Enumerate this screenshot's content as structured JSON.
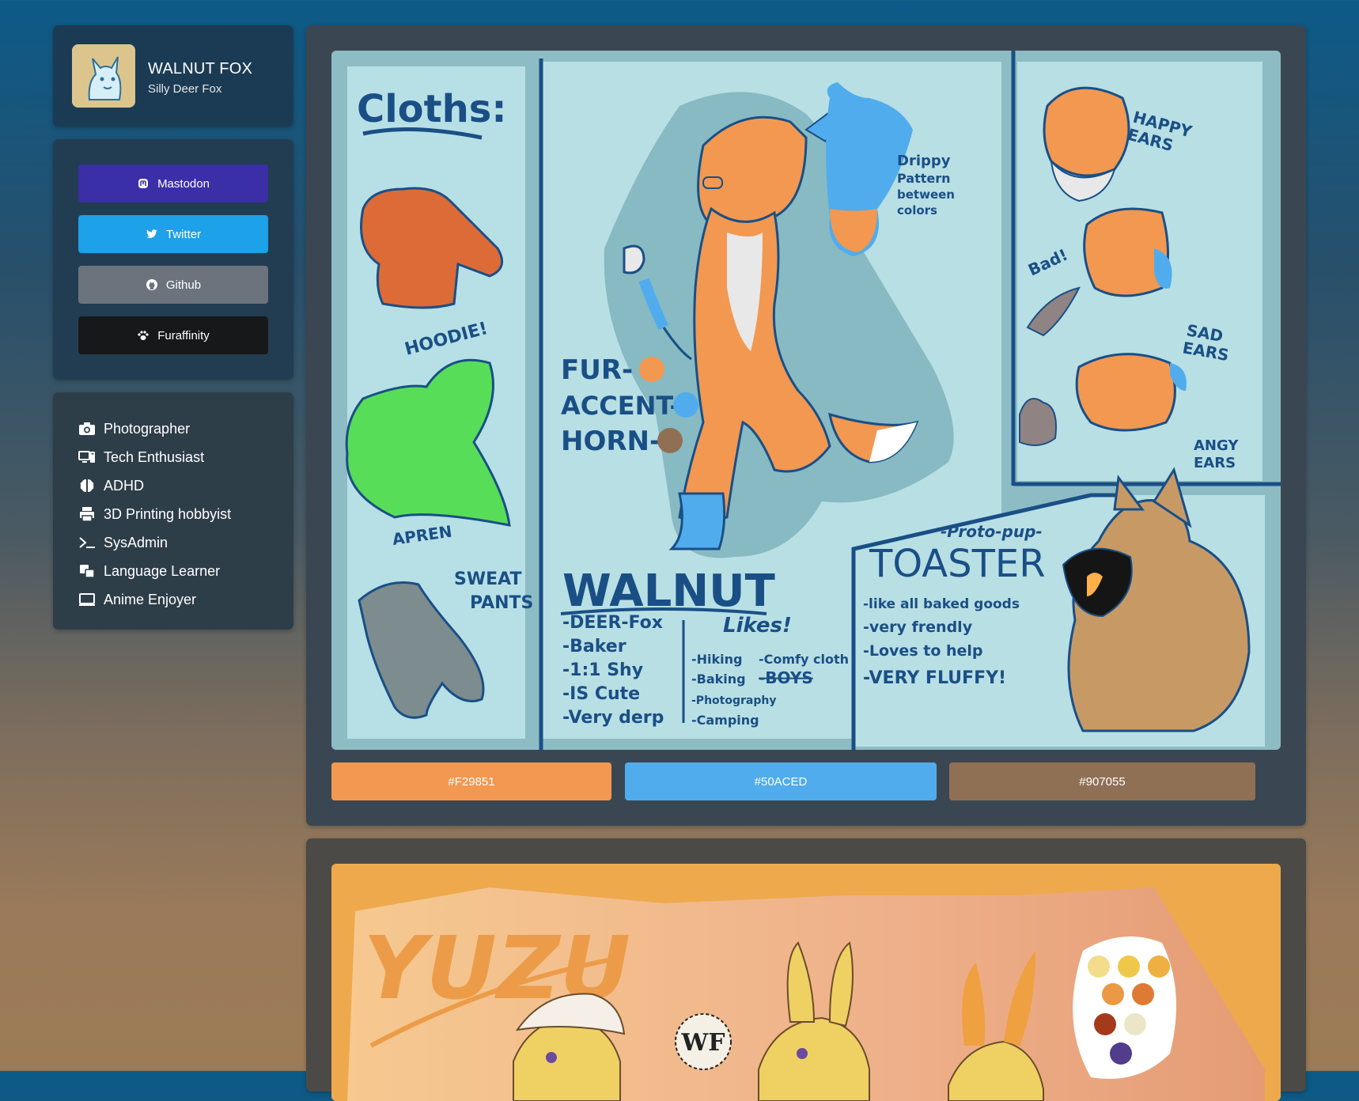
{
  "profile": {
    "name": "WALNUT FOX",
    "subtitle": "Silly Deer Fox"
  },
  "links": [
    {
      "label": "Mastodon",
      "icon": "mastodon-icon",
      "color": "#3b2fa8"
    },
    {
      "label": "Twitter",
      "icon": "twitter-icon",
      "color": "#1da1e8"
    },
    {
      "label": "Github",
      "icon": "github-icon",
      "color": "#6b737d"
    },
    {
      "label": "Furaffinity",
      "icon": "paw-icon",
      "color": "#17181a"
    }
  ],
  "about": [
    {
      "label": "Photographer",
      "icon": "camera-icon"
    },
    {
      "label": "Tech Enthusiast",
      "icon": "computer-icon"
    },
    {
      "label": "ADHD",
      "icon": "brain-icon"
    },
    {
      "label": "3D Printing hobbyist",
      "icon": "printer-icon"
    },
    {
      "label": "SysAdmin",
      "icon": "terminal-icon"
    },
    {
      "label": "Language Learner",
      "icon": "language-icon"
    },
    {
      "label": "Anime Enjoyer",
      "icon": "monitor-icon"
    }
  ],
  "refsheet": {
    "clothes_title": "Cloths:",
    "hoodie": "HOODIE!",
    "apron": "APREN",
    "sweatpants_1": "SWEAT",
    "sweatpants_2": "PANTS",
    "fur": "FUR-",
    "accent": "ACCENT-",
    "horn": "HORN-",
    "drippy_1": "Drippy",
    "drippy_2": "Pattern",
    "drippy_3": "between",
    "drippy_4": "colors",
    "happy_1": "HAPPY",
    "happy_2": "EARS",
    "bad": "Bad!",
    "sad_1": "SAD",
    "sad_2": "EARS",
    "angy_1": "ANGY",
    "angy_2": "EARS",
    "name": "WALNUT",
    "traits": [
      "-DEER-Fox",
      "-Baker",
      "-1:1 Shy",
      "-IS Cute",
      "-Very derp"
    ],
    "likes_title": "Likes!",
    "likes_col1": [
      "-Hiking",
      "-Baking",
      "-Photography",
      "-Camping"
    ],
    "likes_col2": [
      "-Comfy cloth",
      "-BOYS"
    ],
    "proto": "-Proto-pup-",
    "toaster": "TOASTER",
    "toaster_traits": [
      "-like all baked goods",
      "-very frendly",
      "-Loves to help",
      "-VERY FLUFFY!"
    ]
  },
  "swatches": [
    {
      "label": "#F29851",
      "color": "#f29851"
    },
    {
      "label": "#50ACED",
      "color": "#50aced"
    },
    {
      "label": "#907055",
      "color": "#907055"
    }
  ],
  "refsheet2": {
    "title": "YUZU",
    "logo": "WF"
  }
}
